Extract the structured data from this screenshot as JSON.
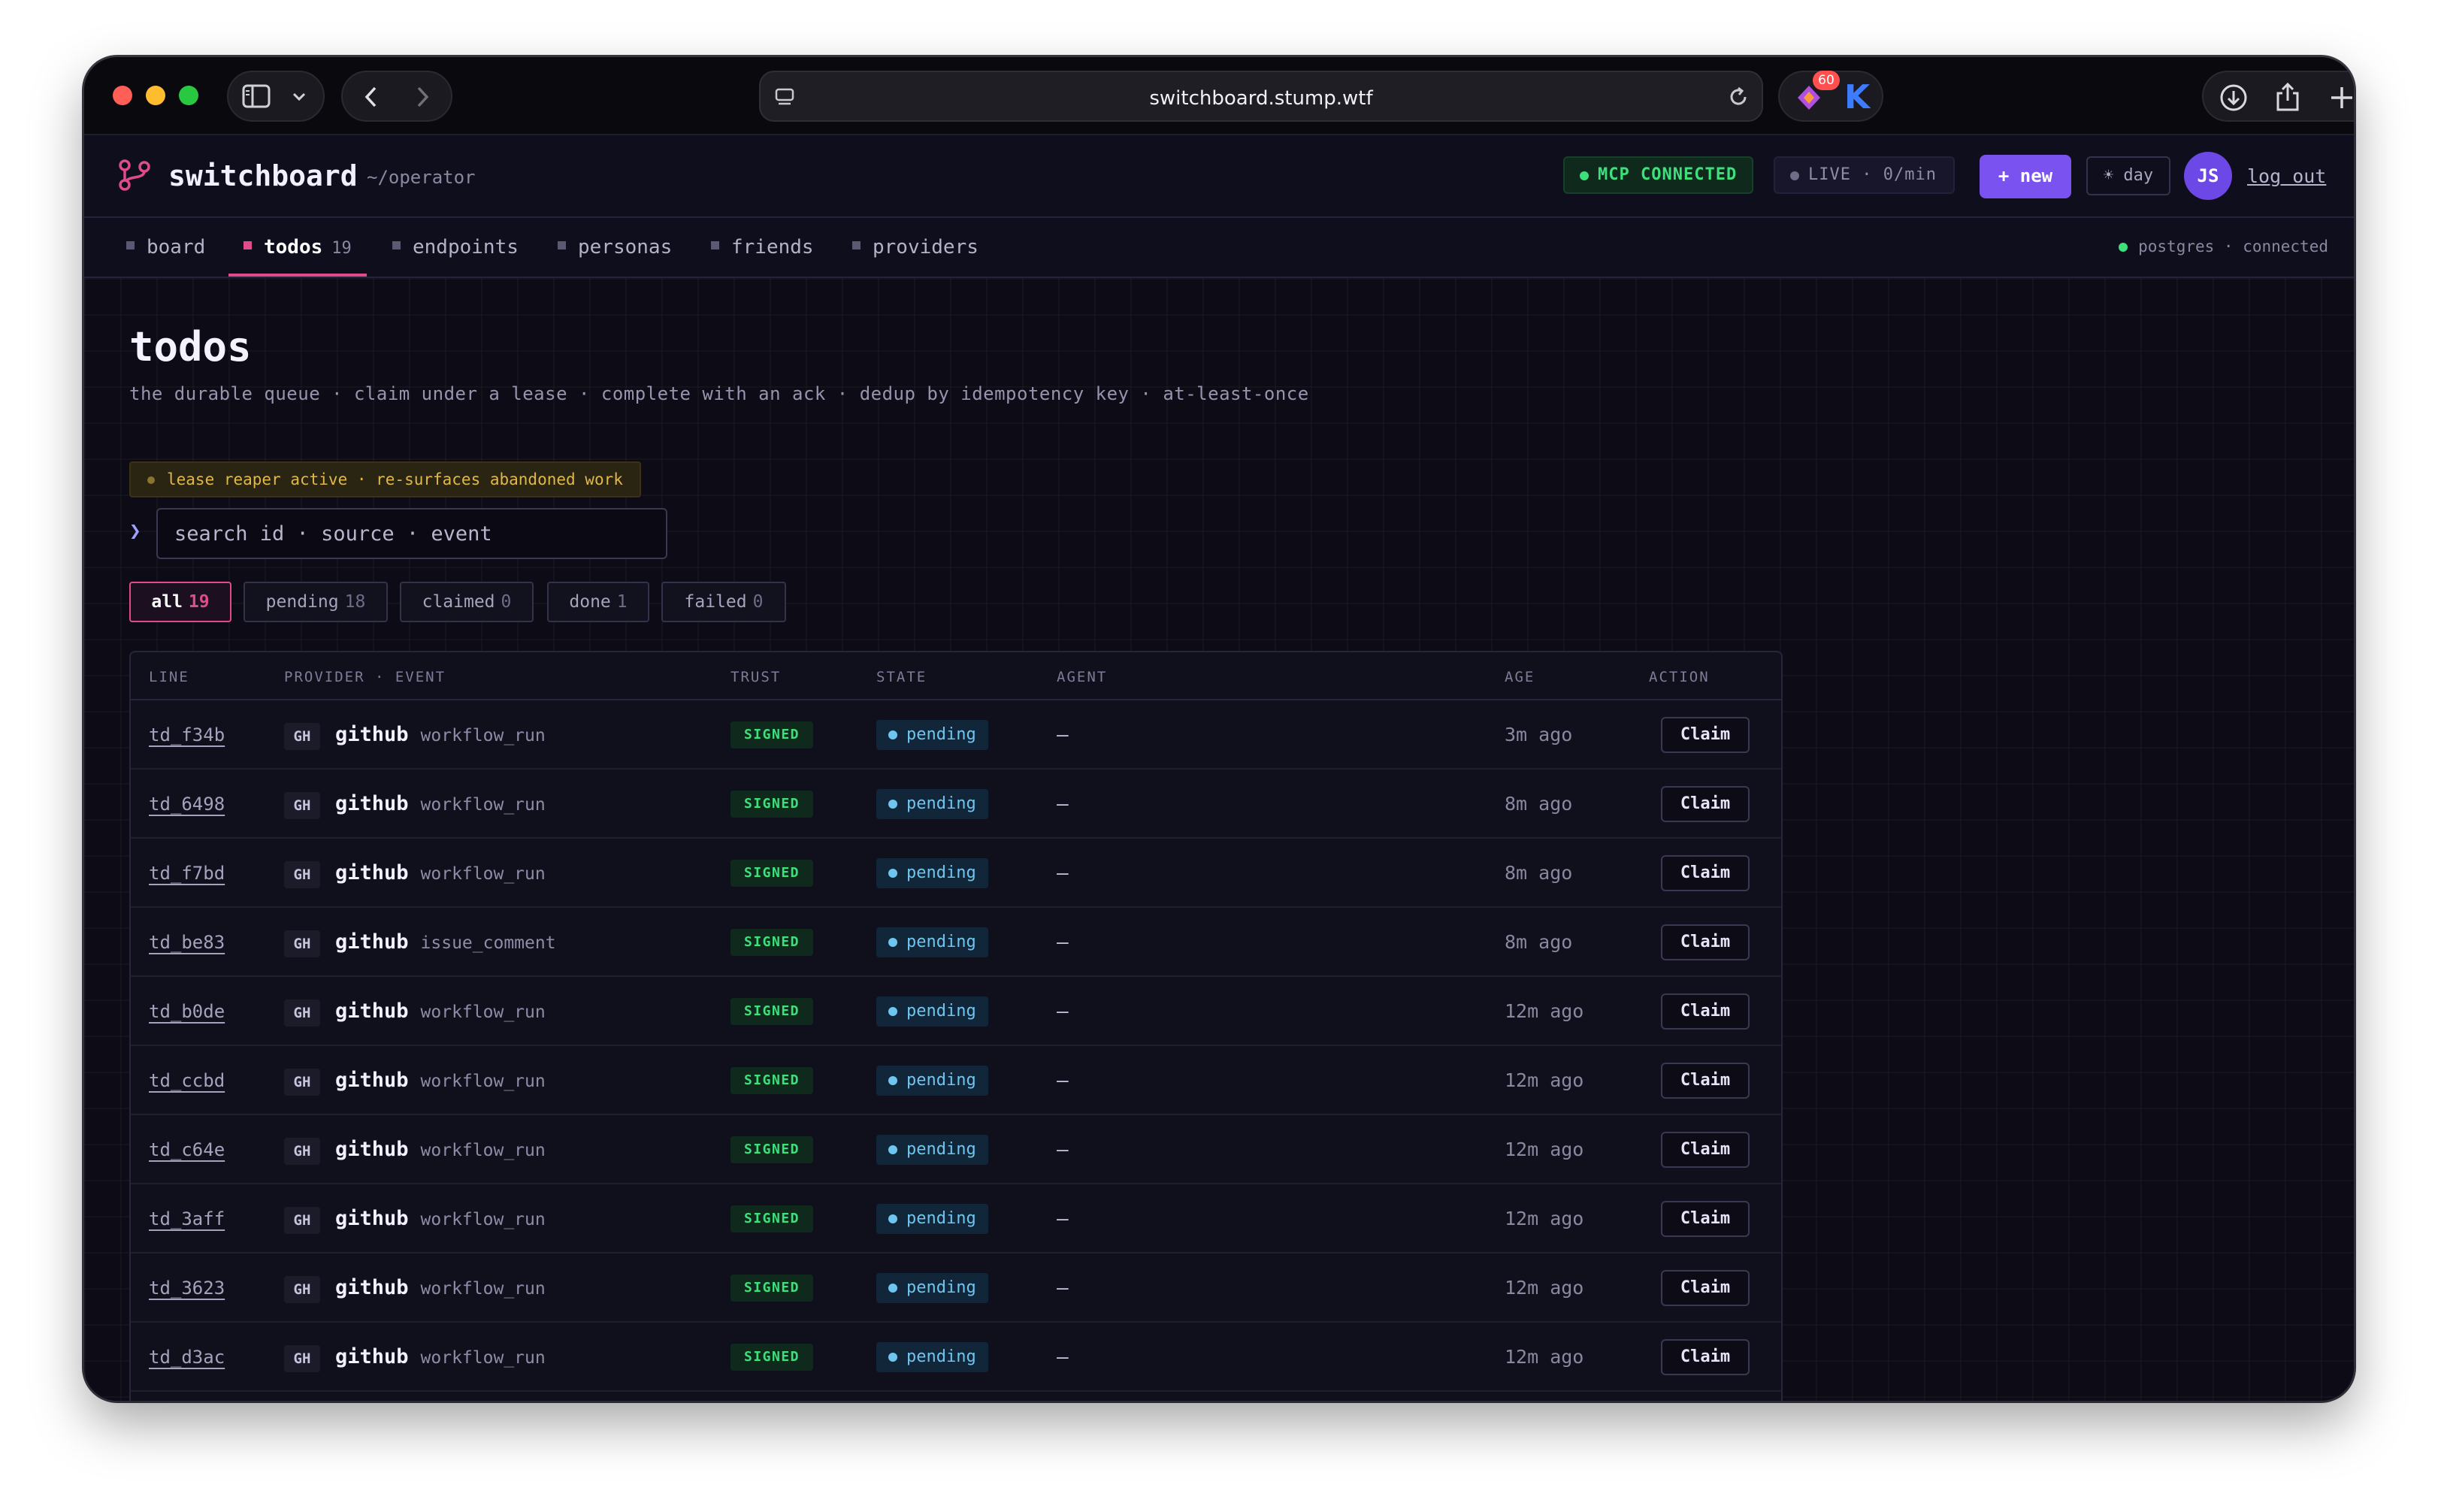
{
  "browser": {
    "url": "switchboard.stump.wtf",
    "extension_badge": "60"
  },
  "app": {
    "name": "switchboard",
    "path": "~/operator",
    "mcp_status": "MCP CONNECTED",
    "live_status": "LIVE · 0/min",
    "new_button": "+ new",
    "theme_button": "☀ day",
    "avatar_initials": "JS",
    "logout": "log out"
  },
  "nav": {
    "tabs": [
      {
        "label": "board",
        "count": ""
      },
      {
        "label": "todos",
        "count": "19"
      },
      {
        "label": "endpoints",
        "count": ""
      },
      {
        "label": "personas",
        "count": ""
      },
      {
        "label": "friends",
        "count": ""
      },
      {
        "label": "providers",
        "count": ""
      }
    ],
    "active_tab": "todos",
    "db_status": "postgres · connected"
  },
  "page": {
    "title": "todos",
    "subtitle": "the durable queue · claim under a lease · complete with an ack · dedup by idempotency key · at-least-once",
    "reaper_notice": "lease reaper active · re-surfaces abandoned work",
    "search_prompt": "❯",
    "search_placeholder": "search id · source · event"
  },
  "filters": [
    {
      "label": "all",
      "count": "19"
    },
    {
      "label": "pending",
      "count": "18"
    },
    {
      "label": "claimed",
      "count": "0"
    },
    {
      "label": "done",
      "count": "1"
    },
    {
      "label": "failed",
      "count": "0"
    }
  ],
  "table": {
    "headers": {
      "line": "LINE",
      "provider_event": "PROVIDER · EVENT",
      "trust": "TRUST",
      "state": "STATE",
      "agent": "AGENT",
      "age": "AGE",
      "action": "ACTION"
    },
    "rows": [
      {
        "line": "td_f34b",
        "provider_abbr": "GH",
        "provider": "github",
        "event": "workflow_run",
        "trust": "SIGNED",
        "state": "pending",
        "agent": "—",
        "age": "3m ago",
        "action": "Claim"
      },
      {
        "line": "td_6498",
        "provider_abbr": "GH",
        "provider": "github",
        "event": "workflow_run",
        "trust": "SIGNED",
        "state": "pending",
        "agent": "—",
        "age": "8m ago",
        "action": "Claim"
      },
      {
        "line": "td_f7bd",
        "provider_abbr": "GH",
        "provider": "github",
        "event": "workflow_run",
        "trust": "SIGNED",
        "state": "pending",
        "agent": "—",
        "age": "8m ago",
        "action": "Claim"
      },
      {
        "line": "td_be83",
        "provider_abbr": "GH",
        "provider": "github",
        "event": "issue_comment",
        "trust": "SIGNED",
        "state": "pending",
        "agent": "—",
        "age": "8m ago",
        "action": "Claim"
      },
      {
        "line": "td_b0de",
        "provider_abbr": "GH",
        "provider": "github",
        "event": "workflow_run",
        "trust": "SIGNED",
        "state": "pending",
        "agent": "—",
        "age": "12m ago",
        "action": "Claim"
      },
      {
        "line": "td_ccbd",
        "provider_abbr": "GH",
        "provider": "github",
        "event": "workflow_run",
        "trust": "SIGNED",
        "state": "pending",
        "agent": "—",
        "age": "12m ago",
        "action": "Claim"
      },
      {
        "line": "td_c64e",
        "provider_abbr": "GH",
        "provider": "github",
        "event": "workflow_run",
        "trust": "SIGNED",
        "state": "pending",
        "agent": "—",
        "age": "12m ago",
        "action": "Claim"
      },
      {
        "line": "td_3aff",
        "provider_abbr": "GH",
        "provider": "github",
        "event": "workflow_run",
        "trust": "SIGNED",
        "state": "pending",
        "agent": "—",
        "age": "12m ago",
        "action": "Claim"
      },
      {
        "line": "td_3623",
        "provider_abbr": "GH",
        "provider": "github",
        "event": "workflow_run",
        "trust": "SIGNED",
        "state": "pending",
        "agent": "—",
        "age": "12m ago",
        "action": "Claim"
      },
      {
        "line": "td_d3ac",
        "provider_abbr": "GH",
        "provider": "github",
        "event": "workflow_run",
        "trust": "SIGNED",
        "state": "pending",
        "agent": "—",
        "age": "12m ago",
        "action": "Claim"
      }
    ]
  },
  "colors": {
    "accent": "#e04c8a",
    "primary": "#7a52f0",
    "success": "#3ee07c",
    "info": "#6ec6f0",
    "warning": "#e0b84a",
    "background": "#0d0c16"
  },
  "icons": [
    "close-icon",
    "minimize-icon",
    "maximize-icon",
    "sidebar-icon",
    "chevron-down-icon",
    "back-icon",
    "forward-icon",
    "page-icon",
    "reload-icon",
    "extension-icon",
    "k-extension-icon",
    "download-icon",
    "share-icon",
    "new-tab-icon",
    "tabs-overview-icon",
    "branch-icon"
  ]
}
